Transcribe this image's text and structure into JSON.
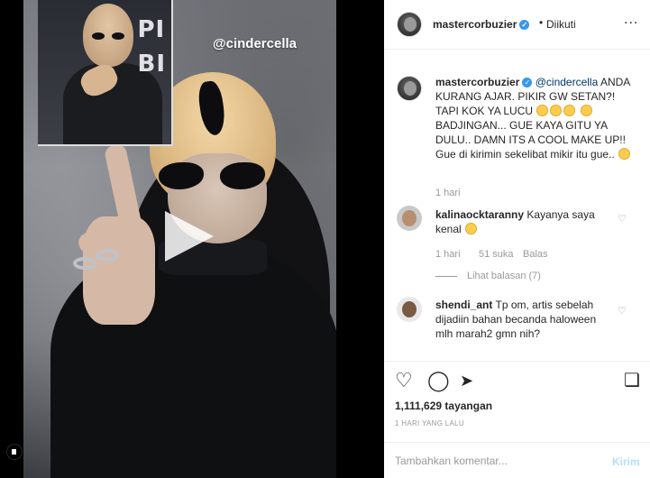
{
  "media": {
    "overlay_handle": "@cindercella",
    "inset_text": "PI\nBI"
  },
  "header": {
    "username": "mastercorbuzier",
    "separator": "•",
    "follow_status": "Diikuti",
    "more_icon": "..."
  },
  "caption": {
    "username": "mastercorbuzier",
    "mention": "@cindercella",
    "text_1": "ANDA KURANG AJAR. PIKIR GW SETAN?! TAPI KOK YA LUCU",
    "text_2": "BADJINGAN... GUE KAYA GITU YA DULU.. DAMN ITS A COOL MAKE UP!! Gue di kirimin sekelibat mikir itu gue..",
    "time": "1 hari"
  },
  "comments": [
    {
      "username": "kalinaocktaranny",
      "text": "Kayanya saya kenal",
      "time": "1 hari",
      "likes": "51 suka",
      "reply": "Balas",
      "view_replies": "Lihat balasan (7)"
    },
    {
      "username": "shendi_ant",
      "text": "Tp om, artis sebelah dijadiin bahan becanda haloween mlh marah2 gmn nih?"
    }
  ],
  "stats": {
    "views": "1,111,629 tayangan",
    "time": "1 HARI YANG LALU"
  },
  "composer": {
    "placeholder": "Tambahkan komentar...",
    "post_label": "Kirim"
  }
}
